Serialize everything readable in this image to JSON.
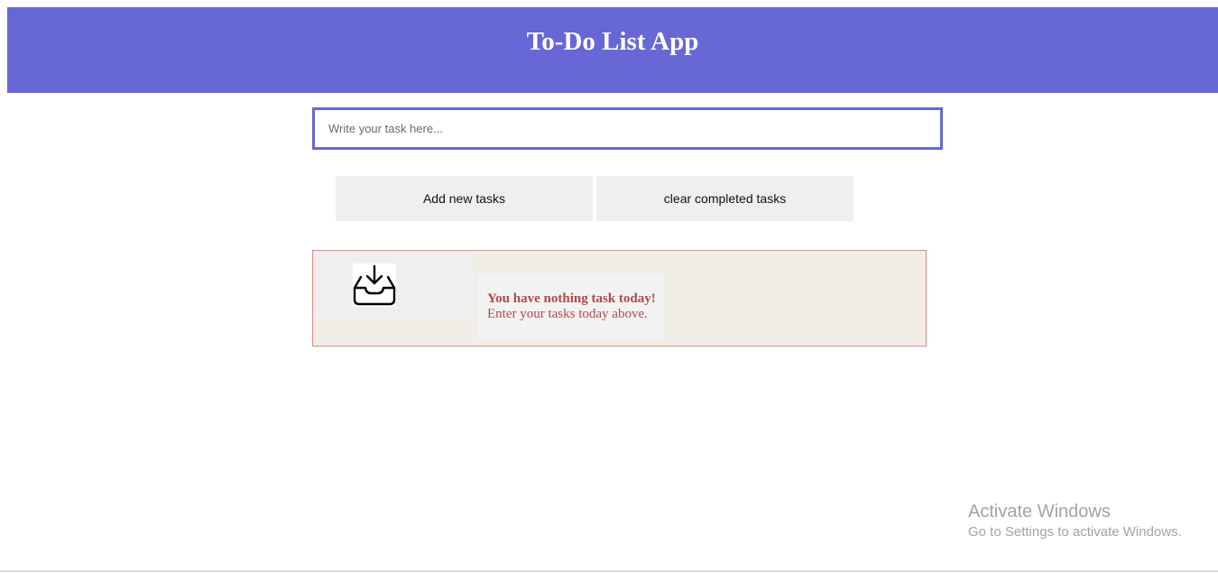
{
  "header": {
    "title": "To-Do List App",
    "background_color": "#6767d6"
  },
  "task_input": {
    "placeholder": "Write your task here...",
    "value": "",
    "border_color": "#6767d6"
  },
  "buttons": {
    "add_label": "Add new tasks",
    "clear_label": "clear completed tasks"
  },
  "empty_state": {
    "icon": "inbox-download-icon",
    "title": "You have nothing task today!",
    "subtitle": "Enter your tasks today above.",
    "text_color": "#b04a4a",
    "border_color": "#e08a8a"
  },
  "watermark": {
    "title": "Activate Windows",
    "subtitle": "Go to Settings to activate Windows."
  }
}
